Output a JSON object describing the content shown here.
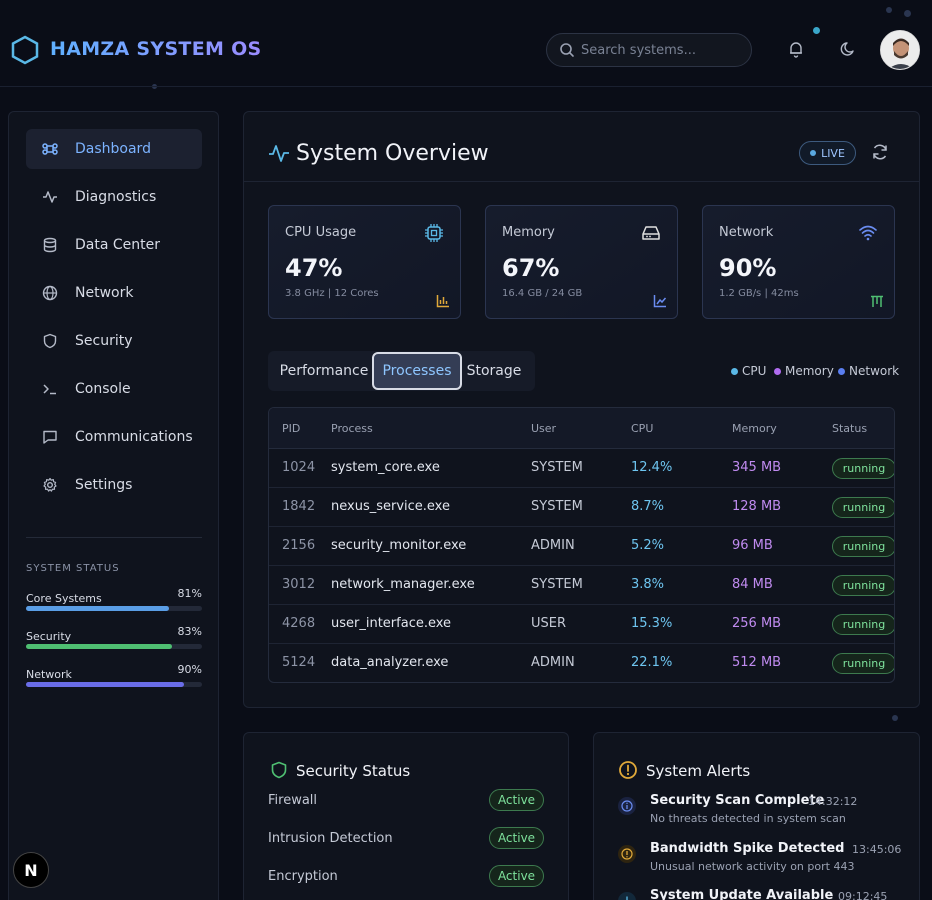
{
  "app": {
    "brand": "HAMZA SYSTEM OS"
  },
  "search": {
    "placeholder": "Search systems..."
  },
  "sidebar": {
    "items": [
      {
        "label": "Dashboard",
        "icon": "command-icon",
        "active": true
      },
      {
        "label": "Diagnostics",
        "icon": "activity-icon"
      },
      {
        "label": "Data Center",
        "icon": "database-icon"
      },
      {
        "label": "Network",
        "icon": "globe-icon"
      },
      {
        "label": "Security",
        "icon": "shield-icon"
      },
      {
        "label": "Console",
        "icon": "terminal-icon"
      },
      {
        "label": "Communications",
        "icon": "message-icon"
      },
      {
        "label": "Settings",
        "icon": "gear-icon"
      }
    ],
    "status_title": "SYSTEM STATUS",
    "status": [
      {
        "label": "Core Systems",
        "value": "81%",
        "fraction": 0.81,
        "color": "#5a9ee6"
      },
      {
        "label": "Security",
        "value": "83%",
        "fraction": 0.83,
        "color": "#4fbf72"
      },
      {
        "label": "Network",
        "value": "90%",
        "fraction": 0.9,
        "color": "#6a6de8"
      }
    ]
  },
  "overview": {
    "title": "System Overview",
    "live_label": "LIVE",
    "cards": [
      {
        "label": "CPU Usage",
        "value": "47%",
        "sub": "3.8 GHz | 12 Cores",
        "icon": "cpu-icon",
        "accent": "#5ab8e6"
      },
      {
        "label": "Memory",
        "value": "67%",
        "sub": "16.4 GB / 24 GB",
        "icon": "hard-drive-icon",
        "accent": "#e0e0e0"
      },
      {
        "label": "Network",
        "value": "90%",
        "sub": "1.2 GB/s | 42ms",
        "icon": "wifi-icon",
        "accent": "#6a8cf0"
      }
    ],
    "tabs": [
      {
        "label": "Performance"
      },
      {
        "label": "Processes",
        "active": true
      },
      {
        "label": "Storage"
      }
    ],
    "legend": [
      {
        "label": "CPU",
        "color": "#5ab8e6"
      },
      {
        "label": "Memory",
        "color": "#b06cf0"
      },
      {
        "label": "Network",
        "color": "#5a7ef0"
      }
    ],
    "table": {
      "headers": [
        "PID",
        "Process",
        "User",
        "CPU",
        "Memory",
        "Status"
      ],
      "rows": [
        {
          "pid": "1024",
          "process": "system_core.exe",
          "user": "SYSTEM",
          "cpu": "12.4%",
          "memory": "345 MB",
          "status": "running"
        },
        {
          "pid": "1842",
          "process": "nexus_service.exe",
          "user": "SYSTEM",
          "cpu": "8.7%",
          "memory": "128 MB",
          "status": "running"
        },
        {
          "pid": "2156",
          "process": "security_monitor.exe",
          "user": "ADMIN",
          "cpu": "5.2%",
          "memory": "96 MB",
          "status": "running"
        },
        {
          "pid": "3012",
          "process": "network_manager.exe",
          "user": "SYSTEM",
          "cpu": "3.8%",
          "memory": "84 MB",
          "status": "running"
        },
        {
          "pid": "4268",
          "process": "user_interface.exe",
          "user": "USER",
          "cpu": "15.3%",
          "memory": "256 MB",
          "status": "running"
        },
        {
          "pid": "5124",
          "process": "data_analyzer.exe",
          "user": "ADMIN",
          "cpu": "22.1%",
          "memory": "512 MB",
          "status": "running"
        }
      ]
    }
  },
  "security": {
    "title": "Security Status",
    "items": [
      {
        "label": "Firewall",
        "status": "Active"
      },
      {
        "label": "Intrusion Detection",
        "status": "Active"
      },
      {
        "label": "Encryption",
        "status": "Active"
      }
    ]
  },
  "alerts": {
    "title": "System Alerts",
    "items": [
      {
        "title": "Security Scan Complete",
        "time": "14:32:12",
        "desc": "No threats detected in system scan",
        "icon": "info-icon"
      },
      {
        "title": "Bandwidth Spike Detected",
        "time": "13:45:06",
        "desc": "Unusual network activity on port 443",
        "icon": "warning-icon"
      },
      {
        "title": "System Update Available",
        "time": "09:12:45",
        "desc": "",
        "icon": "download-icon"
      }
    ]
  },
  "framework_badge": "N"
}
